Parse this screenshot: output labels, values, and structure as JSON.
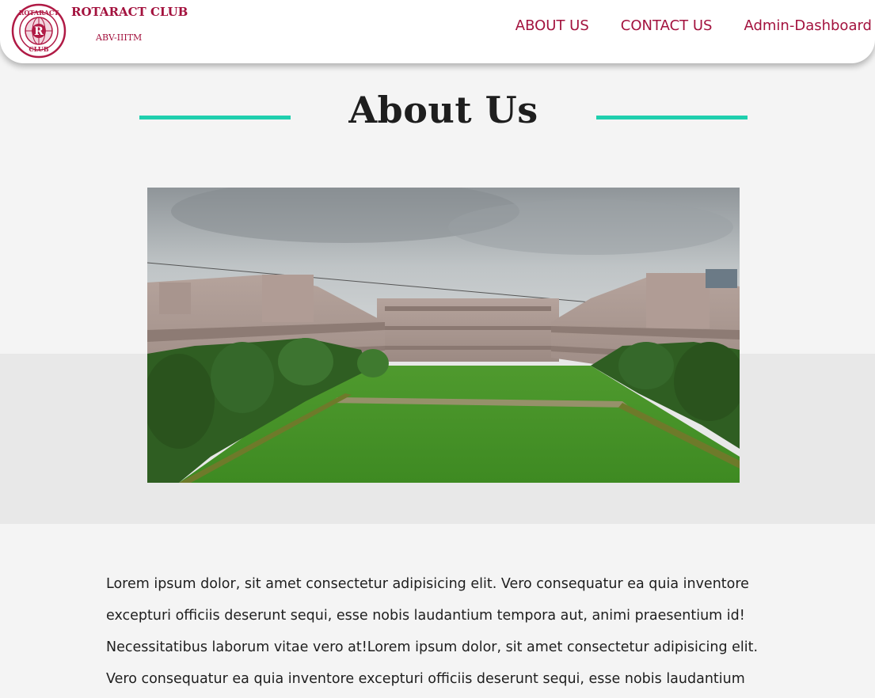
{
  "header": {
    "brand_title": "ROTARACT CLUB",
    "brand_subtitle": "ABV-IIITM",
    "logo_text_top": "ROTARACT",
    "logo_text_bottom": "CLUB",
    "logo_letter": "R",
    "nav": [
      {
        "label": "ABOUT US"
      },
      {
        "label": "CONTACT US"
      },
      {
        "label": "Admin-Dashboard"
      }
    ]
  },
  "main": {
    "heading": "About Us",
    "photo_alt": "Campus building with courtyard lawn",
    "body": "Lorem ipsum dolor, sit amet consectetur adipisicing elit. Vero consequatur ea quia inventore excepturi officiis deserunt sequi, esse nobis laudantium tempora aut, animi praesentium id! Necessitatibus laborum vitae vero at!Lorem ipsum dolor, sit amet consectetur adipisicing elit. Vero consequatur ea quia inventore excepturi officiis deserunt sequi, esse nobis laudantium"
  },
  "colors": {
    "brand": "#a3123e",
    "accent_rule": "#1fcfae",
    "page_bg": "#f4f4f4",
    "band_bg": "#e8e8e8"
  }
}
